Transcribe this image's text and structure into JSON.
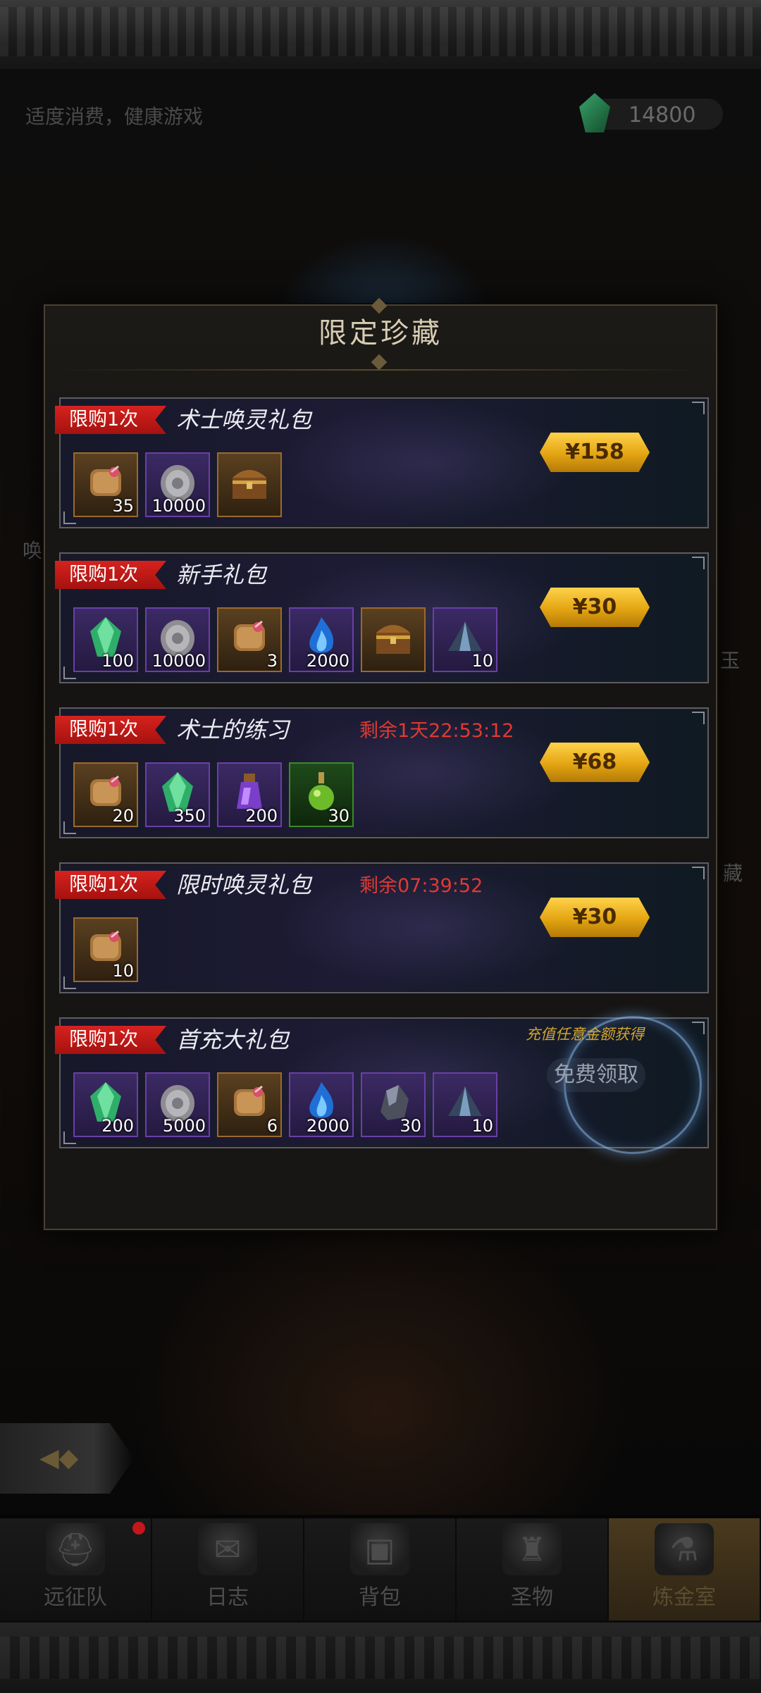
{
  "header": {
    "notice": "适度消费，健康游戏",
    "currency": "14800",
    "currency_icon": "green-gem-icon"
  },
  "side": {
    "left_label": "唤",
    "right_label_1": "玉",
    "right_label_2": "藏"
  },
  "modal": {
    "title": "限定珍藏",
    "packs": [
      {
        "limit": "限购1次",
        "name": "术士唤灵礼包",
        "timer": "",
        "price": "¥158",
        "items": [
          {
            "icon": "scroll-icon",
            "count": "35"
          },
          {
            "icon": "silver-coin-icon",
            "count": "10000"
          },
          {
            "icon": "treasure-chest-icon",
            "count": ""
          }
        ]
      },
      {
        "limit": "限购1次",
        "name": "新手礼包",
        "timer": "",
        "price": "¥30",
        "items": [
          {
            "icon": "green-gem-icon",
            "count": "100"
          },
          {
            "icon": "silver-coin-icon",
            "count": "10000"
          },
          {
            "icon": "scroll-icon",
            "count": "3"
          },
          {
            "icon": "blue-flame-icon",
            "count": "2000"
          },
          {
            "icon": "treasure-chest-icon",
            "count": ""
          },
          {
            "icon": "crystal-shard-icon",
            "count": "10"
          }
        ]
      },
      {
        "limit": "限购1次",
        "name": "术士的练习",
        "timer": "剩余1天22:53:12",
        "price": "¥68",
        "items": [
          {
            "icon": "scroll-icon",
            "count": "20"
          },
          {
            "icon": "green-gem-icon",
            "count": "350"
          },
          {
            "icon": "purple-potion-icon",
            "count": "200"
          },
          {
            "icon": "green-potion-icon",
            "count": "30"
          }
        ]
      },
      {
        "limit": "限购1次",
        "name": "限时唤灵礼包",
        "timer": "剩余07:39:52",
        "price": "¥30",
        "items": [
          {
            "icon": "scroll-icon",
            "count": "10"
          }
        ]
      },
      {
        "limit": "限购1次",
        "name": "首充大礼包",
        "timer": "",
        "free_hint": "充值任意金额获得",
        "free_label": "免费领取",
        "items": [
          {
            "icon": "green-gem-icon",
            "count": "200"
          },
          {
            "icon": "silver-coin-icon",
            "count": "5000"
          },
          {
            "icon": "scroll-icon",
            "count": "6"
          },
          {
            "icon": "blue-flame-icon",
            "count": "2000"
          },
          {
            "icon": "iron-ore-icon",
            "count": "30"
          },
          {
            "icon": "crystal-shard-icon",
            "count": "10"
          }
        ]
      }
    ]
  },
  "nav": {
    "items": [
      {
        "label": "远征队",
        "icon": "viking-helmet-icon"
      },
      {
        "label": "日志",
        "icon": "map-scroll-icon"
      },
      {
        "label": "背包",
        "icon": "backpack-icon"
      },
      {
        "label": "圣物",
        "icon": "relic-torch-icon"
      },
      {
        "label": "炼金室",
        "icon": "alchemy-icon"
      }
    ],
    "active": "炼金室"
  }
}
